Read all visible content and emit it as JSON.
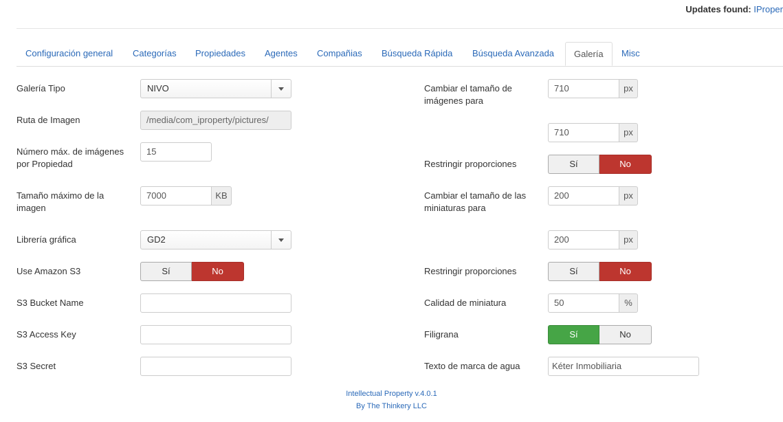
{
  "topbar": {
    "label": "Updates found:",
    "link": "IProper"
  },
  "tabs": [
    "Configuración general",
    "Categorías",
    "Propiedades",
    "Agentes",
    "Compañias",
    "Búsqueda Rápida",
    "Búsqueda Avanzada",
    "Galería",
    "Misc"
  ],
  "active_tab": "Galería",
  "left": {
    "gallery_type": {
      "label": "Galería Tipo",
      "value": "NIVO"
    },
    "image_path": {
      "label": "Ruta de Imagen",
      "value": "/media/com_iproperty/pictures/"
    },
    "max_images": {
      "label": "Número máx. de imágenes por Propiedad",
      "value": "15"
    },
    "max_size": {
      "label": "Tamaño máximo de la imagen",
      "value": "7000",
      "unit": "KB"
    },
    "graphics_lib": {
      "label": "Librería gráfica",
      "value": "GD2"
    },
    "amazon_s3": {
      "label": "Use Amazon S3",
      "yes": "Sí",
      "no": "No",
      "selected": "No"
    },
    "s3_bucket": {
      "label": "S3 Bucket Name",
      "value": ""
    },
    "s3_access": {
      "label": "S3 Access Key",
      "value": ""
    },
    "s3_secret": {
      "label": "S3 Secret",
      "value": ""
    }
  },
  "right": {
    "resize_images": {
      "label": "Cambiar el tamaño de imágenes para",
      "width": "710",
      "height": "710",
      "unit": "px"
    },
    "restrict1": {
      "label": "Restringir proporciones",
      "yes": "Sí",
      "no": "No",
      "selected": "No"
    },
    "resize_thumbs": {
      "label": "Cambiar el tamaño de las miniaturas para",
      "width": "200",
      "height": "200",
      "unit": "px"
    },
    "restrict2": {
      "label": "Restringir proporciones",
      "yes": "Sí",
      "no": "No",
      "selected": "No"
    },
    "thumb_quality": {
      "label": "Calidad de miniatura",
      "value": "50",
      "unit": "%"
    },
    "watermark": {
      "label": "Filigrana",
      "yes": "Sí",
      "no": "No",
      "selected": "Sí"
    },
    "watermark_text": {
      "label": "Texto de marca de agua",
      "value": "Kéter Inmobiliaria"
    }
  },
  "footer": {
    "line1": "Intellectual Property v.4.0.1",
    "line2": "By The Thinkery LLC"
  },
  "colors": {
    "link": "#2a69b8",
    "no_active": "#bd362f",
    "yes_active": "#46a546"
  }
}
